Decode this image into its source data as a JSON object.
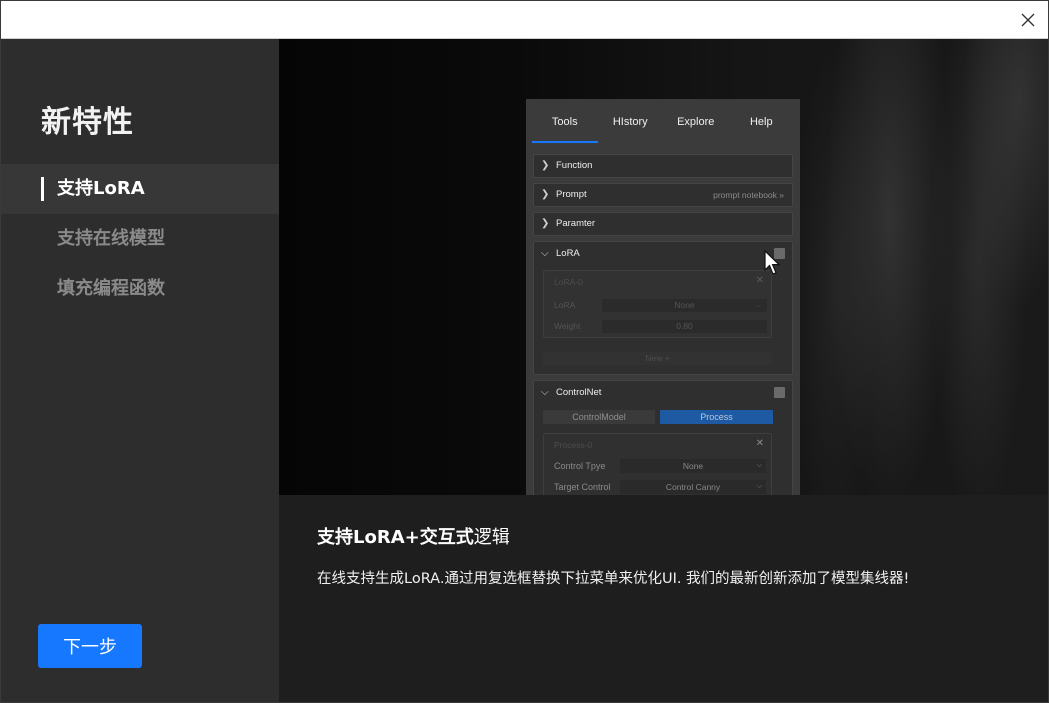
{
  "sidebar": {
    "title": "新特性",
    "items": [
      {
        "label": "支持LoRA"
      },
      {
        "label": "支持在线模型"
      },
      {
        "label": "填充编程函数"
      }
    ],
    "next_label": "下一步"
  },
  "preview_panel": {
    "tabs": [
      {
        "label": "Tools"
      },
      {
        "label": "HIstory"
      },
      {
        "label": "Explore"
      },
      {
        "label": "Help"
      }
    ],
    "sections": {
      "function": "Function",
      "prompt": "Prompt",
      "prompt_link": "prompt notebook »",
      "paramter": "Paramter",
      "lora": "LoRA",
      "controlnet": "ControlNet"
    },
    "lora": {
      "item_title": "LoRA-0",
      "field_lora": "LoRA",
      "field_lora_value": "None",
      "field_weight": "Weight",
      "field_weight_value": "0.80",
      "new_label": "New +"
    },
    "controlnet": {
      "control_model": "ControlModel",
      "process": "Process",
      "process_item": "Process-0",
      "control_type_label": "Control Tpye",
      "control_type_value": "None",
      "target_control_label": "Target Control",
      "target_control_value": "Control Canny"
    }
  },
  "info": {
    "title_bold": "支持LoRA+交互式",
    "title_light": "逻辑",
    "description": "在线支持生成LoRA.通过用复选框替换下拉菜单来优化UI. 我们的最新创新添加了模型集线器!"
  },
  "colors": {
    "accent": "#1677ff",
    "sidebar_bg": "#2d2d2d",
    "info_bg": "#1e1e1e"
  },
  "icons": {
    "close": "close-icon",
    "chevron_right": "chevron-right-icon",
    "chevron_down": "chevron-down-icon",
    "cursor": "mouse-cursor-icon"
  }
}
